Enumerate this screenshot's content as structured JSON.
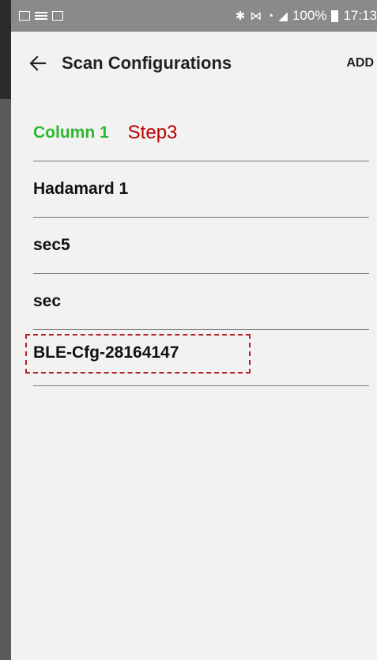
{
  "status_bar": {
    "battery_percent": "100%",
    "time": "17:13"
  },
  "toolbar": {
    "title": "Scan Configurations",
    "add_label": "ADD"
  },
  "annotation": {
    "column_label": "Column 1",
    "step_label": "Step3"
  },
  "configurations": [
    {
      "name": "Hadamard 1"
    },
    {
      "name": "sec5"
    },
    {
      "name": "sec"
    },
    {
      "name": "BLE-Cfg-28164147",
      "highlighted": true
    }
  ],
  "colors": {
    "column_label": "#2eb82e",
    "step_label": "#c00000",
    "highlight_border": "#b22222"
  }
}
